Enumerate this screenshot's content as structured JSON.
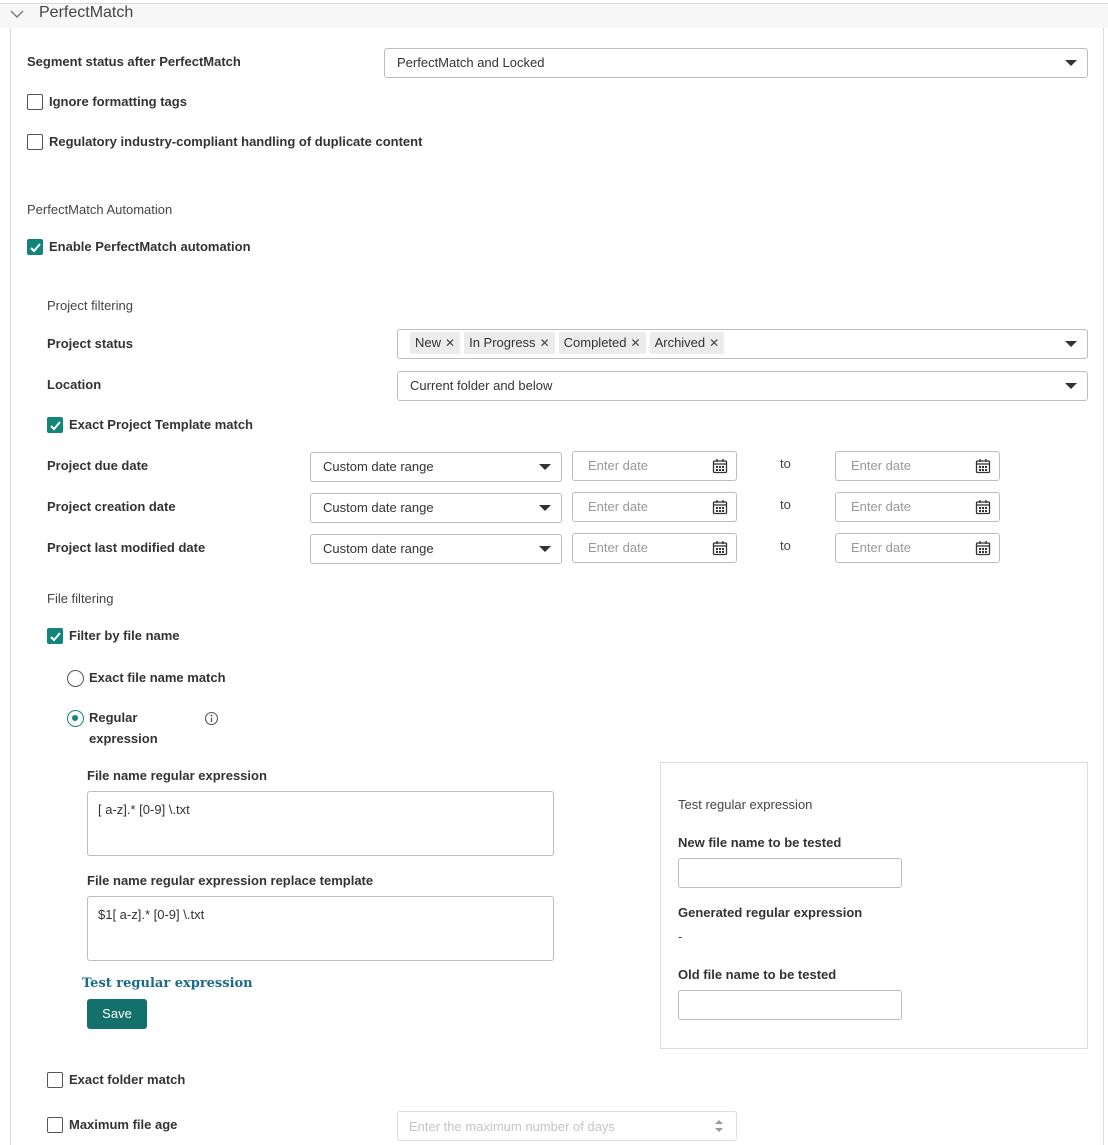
{
  "section": {
    "title": "PerfectMatch"
  },
  "segment_status": {
    "label": "Segment status after PerfectMatch",
    "value": "PerfectMatch and Locked"
  },
  "ignore_formatting": {
    "label": "Ignore formatting tags",
    "checked": false
  },
  "regulatory": {
    "label": "Regulatory industry-compliant handling of duplicate content",
    "checked": false
  },
  "automation": {
    "heading": "PerfectMatch Automation",
    "enable_label": "Enable PerfectMatch automation",
    "enabled": true
  },
  "project_filtering": {
    "heading": "Project filtering",
    "status_label": "Project status",
    "status_tags": [
      "New",
      "In Progress",
      "Completed",
      "Archived"
    ],
    "location_label": "Location",
    "location_value": "Current folder and below",
    "template_match_label": "Exact Project Template match",
    "template_match_checked": true,
    "dates": [
      {
        "label": "Project due date",
        "range": "Custom date range",
        "from_placeholder": "Enter date",
        "to": "to",
        "to_placeholder": "Enter date"
      },
      {
        "label": "Project creation date",
        "range": "Custom date range",
        "from_placeholder": "Enter date",
        "to": "to",
        "to_placeholder": "Enter date"
      },
      {
        "label": "Project last modified date",
        "range": "Custom date range",
        "from_placeholder": "Enter date",
        "to": "to",
        "to_placeholder": "Enter date"
      }
    ]
  },
  "file_filtering": {
    "heading": "File filtering",
    "filter_by_name_label": "Filter by file name",
    "filter_by_name_checked": true,
    "exact_match_label": "Exact file name match",
    "regex_label_line1": "Regular",
    "regex_label_line2": "expression",
    "selected": "regex",
    "regex_field_label": "File name regular expression",
    "regex_value": "[ a-z].* [0-9] \\.txt",
    "replace_field_label": "File name regular expression replace template",
    "replace_value": "$1[ a-z].* [0-9] \\.txt",
    "test_link": "Test regular expression",
    "save_button": "Save",
    "exact_folder_label": "Exact folder match",
    "exact_folder_checked": false,
    "max_age_label": "Maximum file age",
    "max_age_checked": false,
    "max_age_placeholder": "Enter the maximum number of days"
  },
  "test_panel": {
    "heading": "Test regular expression",
    "new_name_label": "New file name to be tested",
    "generated_label": "Generated regular expression",
    "generated_value": "-",
    "old_name_label": "Old file name to be tested"
  },
  "colors": {
    "accent": "#13857a",
    "button": "#13706a",
    "link": "#1b6a8a"
  },
  "icons": [
    "chevron-down-icon",
    "dropdown-caret-icon",
    "calendar-icon",
    "checkmark-icon",
    "remove-tag-icon",
    "info-icon",
    "spinner-arrows-icon"
  ]
}
